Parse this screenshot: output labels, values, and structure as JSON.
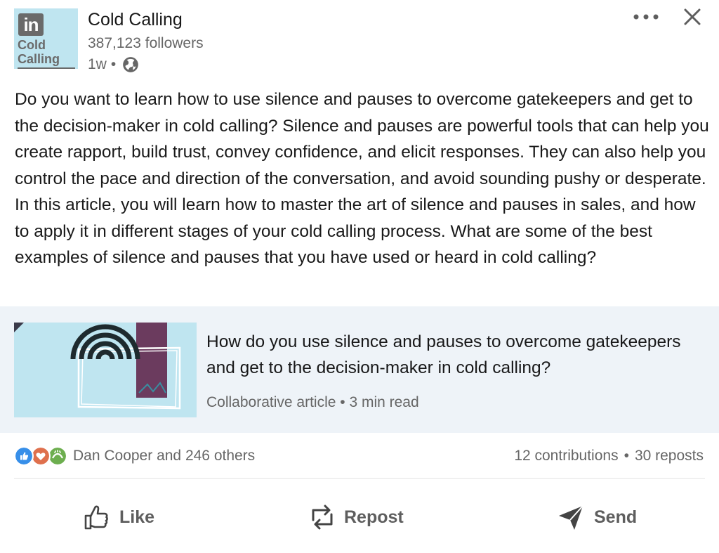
{
  "header": {
    "logo": {
      "badge": "in",
      "line1": "Cold",
      "line2": "Calling"
    },
    "org_name": "Cold Calling",
    "followers": "387,123 followers",
    "time": "1w",
    "separator": "•",
    "visibility_icon": "globe-icon",
    "more_icon": "more-horizontal-icon",
    "close_icon": "close-icon"
  },
  "post": {
    "text": "Do you want to learn how to use silence and pauses to overcome gatekeepers and get to the decision-maker in cold calling? Silence and pauses are powerful tools that can help you create rapport, build trust, convey confidence, and elicit responses. They can also help you control the pace and direction of the conversation, and avoid sounding pushy or desperate. In this article, you will learn how to master the art of silence and pauses in sales, and how to apply it in different stages of your cold calling process. What are some of the best examples of silence and pauses that you have used or heard in cold calling?"
  },
  "article": {
    "title": "How do you use silence and pauses to overcome gatekeepers and get to the decision-maker in cold calling?",
    "meta": "Collaborative article • 3 min read"
  },
  "social": {
    "reaction_icons": [
      "like-icon",
      "love-icon",
      "support-icon"
    ],
    "reactions_text": "Dan Cooper and 246 others",
    "contributions": "12 contributions",
    "separator": "•",
    "reposts": "30 reposts"
  },
  "actions": {
    "like": "Like",
    "repost": "Repost",
    "send": "Send"
  },
  "colors": {
    "logo_bg": "#bfe5f0",
    "logo_fg": "#6a6a6a",
    "article_bg": "#eef3f8",
    "secondary_text": "#666666",
    "like_blue": "#378fe9",
    "love_red": "#df704d",
    "support_green": "#6dae4f"
  }
}
